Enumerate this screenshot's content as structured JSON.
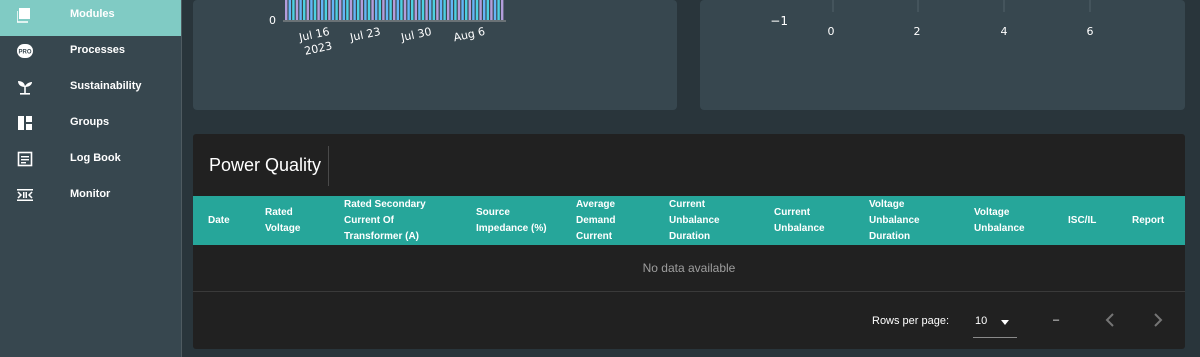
{
  "sidebar": {
    "items": [
      {
        "label": "Modules",
        "icon": "modules-icon",
        "active": true
      },
      {
        "label": "Processes",
        "icon": "pro-icon"
      },
      {
        "label": "Sustainability",
        "icon": "sprout-icon"
      },
      {
        "label": "Groups",
        "icon": "groups-icon"
      },
      {
        "label": "Log Book",
        "icon": "logbook-icon"
      },
      {
        "label": "Monitor",
        "icon": "monitor-icon"
      }
    ],
    "pro_badge_text": "PRO"
  },
  "chart_data": [
    {
      "type": "bar",
      "y_visible_tick": "0",
      "x_ticks": [
        "Jul 16",
        "Jul 23",
        "Jul 30",
        "Aug 6"
      ],
      "x_year_label": "2023",
      "bar_colors": [
        "#b39ddb",
        "#64b5f6",
        "#4dd0e1"
      ]
    },
    {
      "type": "scatter",
      "y_visible_tick": "−1",
      "x_ticks": [
        "0",
        "2",
        "4",
        "6"
      ]
    }
  ],
  "power_quality": {
    "title": "Power Quality",
    "columns": [
      {
        "lines": [
          "Date"
        ]
      },
      {
        "lines": [
          "Rated",
          "Voltage"
        ]
      },
      {
        "lines": [
          "Rated Secondary",
          "Current Of",
          "Transformer (A)"
        ]
      },
      {
        "lines": [
          "Source",
          "Impedance (%)"
        ]
      },
      {
        "lines": [
          "Average",
          "Demand",
          "Current"
        ]
      },
      {
        "lines": [
          "Current",
          "Unbalance",
          "Duration"
        ]
      },
      {
        "lines": [
          "Current",
          "Unbalance"
        ]
      },
      {
        "lines": [
          "Voltage",
          "Unbalance",
          "Duration"
        ]
      },
      {
        "lines": [
          "Voltage",
          "Unbalance"
        ]
      },
      {
        "lines": [
          "ISC/IL"
        ]
      },
      {
        "lines": [
          "Report"
        ]
      }
    ],
    "empty_text": "No data available",
    "footer": {
      "rows_per_page_label": "Rows per page:",
      "rows_per_page_value": "10",
      "range_text": "–"
    }
  },
  "colors": {
    "accent": "#26a69a",
    "active_nav": "#80cbc4",
    "sidebar": "#37474f",
    "background": "#29353b"
  }
}
